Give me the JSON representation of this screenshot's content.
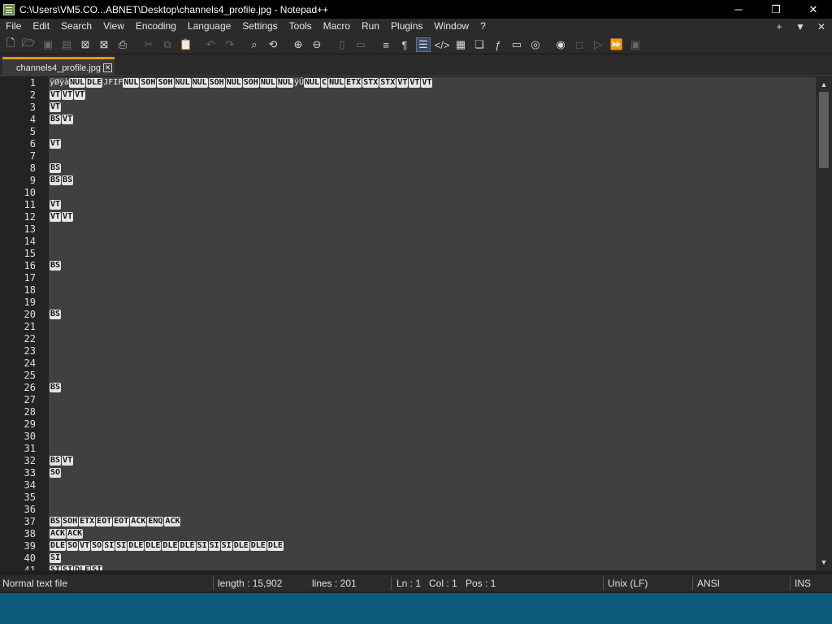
{
  "window": {
    "title": "C:\\Users\\VM5.CO...ABNET\\Desktop\\channels4_profile.jpg - Notepad++",
    "minimize": "─",
    "restore": "❐",
    "close": "✕"
  },
  "menu": {
    "items": [
      "File",
      "Edit",
      "Search",
      "View",
      "Encoding",
      "Language",
      "Settings",
      "Tools",
      "Macro",
      "Run",
      "Plugins",
      "Window",
      "?"
    ],
    "right": [
      "+",
      "▼",
      "✕"
    ]
  },
  "toolbar": {
    "icons": [
      "new-file-icon",
      "open-file-icon",
      "save-icon",
      "save-all-icon",
      "close-icon",
      "close-all-icon",
      "print-icon",
      "cut-icon",
      "copy-icon",
      "paste-icon",
      "undo-icon",
      "redo-icon",
      "find-icon",
      "replace-icon",
      "zoom-in-icon",
      "zoom-out-icon",
      "sync-v-icon",
      "sync-h-icon",
      "word-wrap-icon",
      "show-all-chars-icon",
      "indent-guide-icon",
      "udl-icon",
      "doc-map-icon",
      "doc-list-icon",
      "function-list-icon",
      "folder-workspace-icon",
      "monitoring-icon",
      "record-macro-icon",
      "stop-macro-icon",
      "play-macro-icon",
      "run-macro-multiple-icon",
      "save-macro-icon"
    ]
  },
  "tab": {
    "label": "channels4_profile.jpg",
    "close": "✕"
  },
  "editor": {
    "line1_prefix": "ÿØÿà",
    "line1_ctrls": [
      "NUL",
      "DLE"
    ],
    "line1_text_mid": "JFIF",
    "line1_ctrls2": [
      "NUL",
      "SOH",
      "SOH",
      "NUL",
      "NUL",
      "SOH",
      "NUL",
      "SOH",
      "NUL",
      "NUL"
    ],
    "line1_text_mid2": "ÿÛ",
    "line1_ctrls3": [
      "NUL",
      "C",
      "NUL",
      "ETX",
      "STX",
      "STX",
      "VT",
      "VT",
      "VT"
    ],
    "lines": [
      {
        "n": "2",
        "ctrls": [
          "VT",
          "VT",
          "VT"
        ]
      },
      {
        "n": "3",
        "ctrls": [
          "VT"
        ]
      },
      {
        "n": "4",
        "ctrls": [
          "BS",
          "VT"
        ]
      },
      {
        "n": "5",
        "ctrls": []
      },
      {
        "n": "6",
        "ctrls": [
          "VT"
        ]
      },
      {
        "n": "7",
        "ctrls": []
      },
      {
        "n": "8",
        "ctrls": [
          "BS"
        ]
      },
      {
        "n": "9",
        "ctrls": [
          "BS",
          "BS"
        ]
      },
      {
        "n": "10",
        "ctrls": []
      },
      {
        "n": "11",
        "ctrls": [
          "VT"
        ]
      },
      {
        "n": "12",
        "ctrls": [
          "VT",
          "VT"
        ]
      },
      {
        "n": "13",
        "ctrls": []
      },
      {
        "n": "14",
        "ctrls": []
      },
      {
        "n": "15",
        "ctrls": []
      },
      {
        "n": "16",
        "ctrls": [
          "BS"
        ]
      },
      {
        "n": "17",
        "ctrls": []
      },
      {
        "n": "18",
        "ctrls": []
      },
      {
        "n": "19",
        "ctrls": []
      },
      {
        "n": "20",
        "ctrls": [
          "BS"
        ]
      },
      {
        "n": "21",
        "ctrls": []
      },
      {
        "n": "22",
        "ctrls": []
      },
      {
        "n": "23",
        "ctrls": []
      },
      {
        "n": "24",
        "ctrls": []
      },
      {
        "n": "25",
        "ctrls": []
      },
      {
        "n": "26",
        "ctrls": [
          "BS"
        ]
      },
      {
        "n": "27",
        "ctrls": []
      },
      {
        "n": "28",
        "ctrls": []
      },
      {
        "n": "29",
        "ctrls": []
      },
      {
        "n": "30",
        "ctrls": []
      },
      {
        "n": "31",
        "ctrls": []
      },
      {
        "n": "32",
        "ctrls": [
          "BS",
          "VT"
        ]
      },
      {
        "n": "33",
        "ctrls": [
          "SO"
        ]
      },
      {
        "n": "34",
        "ctrls": []
      },
      {
        "n": "35",
        "ctrls": []
      },
      {
        "n": "36",
        "ctrls": []
      },
      {
        "n": "37",
        "ctrls": [
          "BS",
          "SOH",
          "ETX",
          "EOT",
          "EOT",
          "ACK",
          "ENQ",
          "ACK"
        ]
      },
      {
        "n": "38",
        "ctrls": [
          "ACK",
          "ACK"
        ]
      },
      {
        "n": "39",
        "ctrls": [
          "DLE",
          "SO",
          "VT",
          "SO",
          "SI",
          "SI",
          "DLE",
          "DLE",
          "DLE",
          "DLE",
          "SI",
          "SI",
          "SI",
          "DLE",
          "DLE",
          "DLE"
        ]
      },
      {
        "n": "40",
        "ctrls": [
          "SI"
        ]
      },
      {
        "n": "41",
        "ctrls": [
          "SI",
          "SI",
          "DLE",
          "SI"
        ]
      }
    ]
  },
  "status": {
    "file_type": "Normal text file",
    "length": "length : 15,902",
    "lines": "lines : 201",
    "ln": "Ln : 1",
    "col": "Col : 1",
    "pos": "Pos : 1",
    "eol": "Unix (LF)",
    "encoding": "ANSI",
    "mode": "INS"
  },
  "colors": {
    "tab_accent": "#e6941a",
    "editor_bg": "#404040",
    "gutter_bg": "#232323",
    "desktop": "#0b5a7a"
  }
}
